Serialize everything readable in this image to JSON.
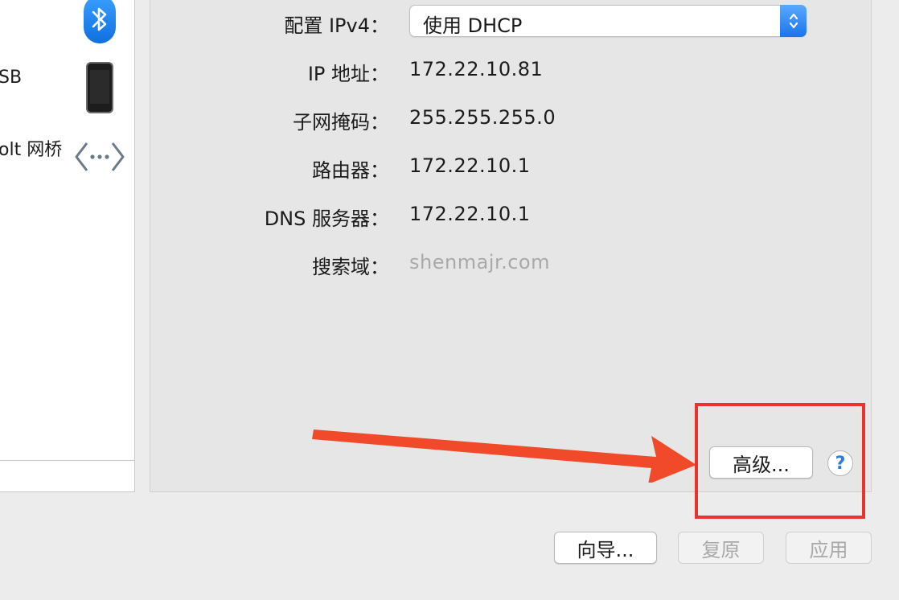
{
  "sidebar": {
    "items": [
      {
        "label": "",
        "icon": "bluetooth-icon"
      },
      {
        "label": "SB",
        "icon": "iphone-icon"
      },
      {
        "label": "olt 网桥",
        "icon": "thunderbolt-bridge-icon"
      }
    ]
  },
  "form": {
    "configure_ipv4": {
      "label": "配置 IPv4：",
      "value": "使用 DHCP"
    },
    "ip_address": {
      "label": "IP 地址：",
      "value": "172.22.10.81"
    },
    "subnet_mask": {
      "label": "子网掩码：",
      "value": "255.255.255.0"
    },
    "router": {
      "label": "路由器：",
      "value": "172.22.10.1"
    },
    "dns": {
      "label": "DNS 服务器：",
      "value": "172.22.10.1"
    },
    "search_domains": {
      "label": "搜索域：",
      "placeholder": "shenmajr.com"
    }
  },
  "buttons": {
    "advanced": "高级...",
    "help": "?",
    "assist": "向导...",
    "revert": "复原",
    "apply": "应用"
  },
  "colors": {
    "accent": "#1b74ea",
    "highlight": "#e8342c"
  }
}
